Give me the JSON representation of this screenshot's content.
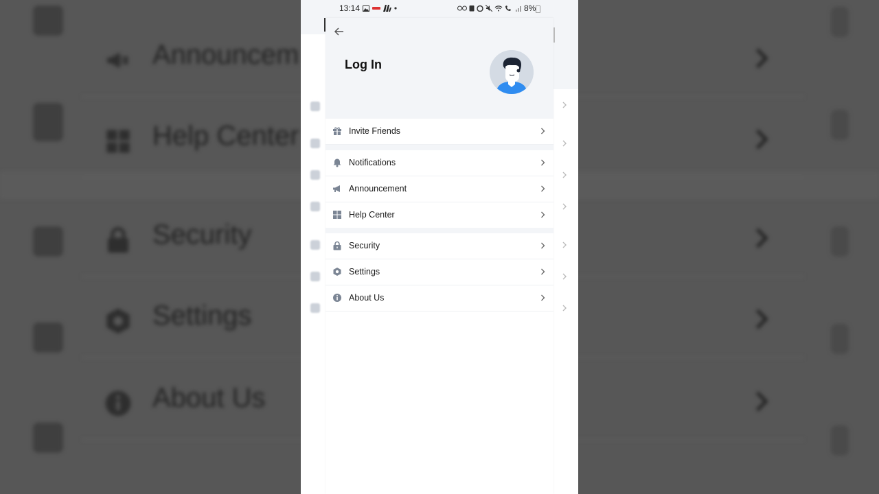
{
  "status_bar": {
    "time": "13:14",
    "battery": "8%"
  },
  "header": {
    "title": "Log In"
  },
  "menu": {
    "section1": [
      {
        "label": "Invite Friends",
        "icon": "gift-icon"
      }
    ],
    "section2": [
      {
        "label": "Notifications",
        "icon": "bell-icon"
      },
      {
        "label": "Announcement",
        "icon": "megaphone-icon"
      },
      {
        "label": "Help Center",
        "icon": "grid-icon"
      }
    ],
    "section3": [
      {
        "label": "Security",
        "icon": "lock-icon"
      },
      {
        "label": "Settings",
        "icon": "hexagon-gear-icon"
      },
      {
        "label": "About Us",
        "icon": "info-icon"
      }
    ]
  },
  "background_blur": {
    "items": [
      "Announcem",
      "Help Center",
      "Security",
      "Settings",
      "About Us"
    ]
  },
  "colors": {
    "header_bg": "#f3f5f8",
    "icon_gray": "#7b8594",
    "avatar_shirt": "#2f8cf0"
  }
}
